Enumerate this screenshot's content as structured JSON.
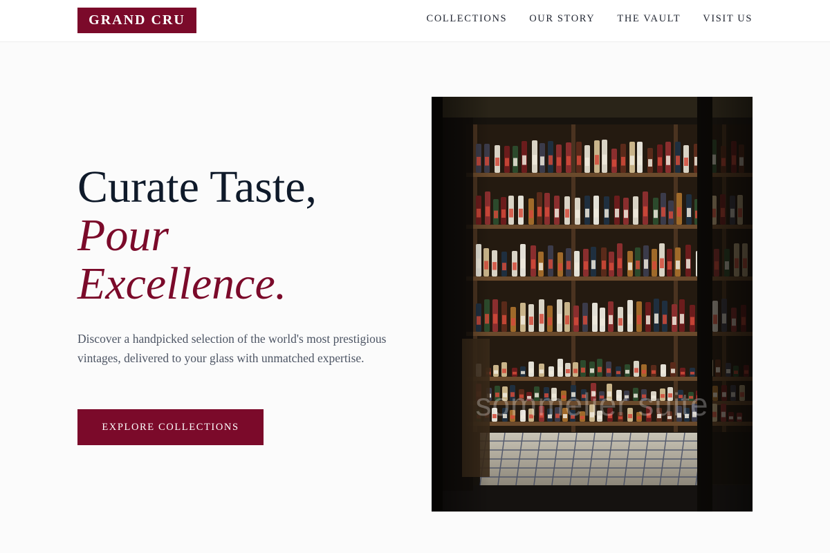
{
  "header": {
    "logo": "GRAND CRU",
    "nav": [
      {
        "label": "COLLECTIONS"
      },
      {
        "label": "OUR STORY"
      },
      {
        "label": "THE VAULT"
      },
      {
        "label": "VISIT US"
      }
    ]
  },
  "hero": {
    "headline_line1": "Curate Taste,",
    "headline_line2": "Pour",
    "headline_line3": "Excellence.",
    "description": "Discover a handpicked selection of the world's most prestigious vintages, delivered to your glass with unmatched expertise.",
    "cta_label": "EXPLORE COLLECTIONS",
    "image_alt": "Bottle shop shelves behind glass doors",
    "watermark": "sommelier suite"
  },
  "colors": {
    "brand": "#7b0a2a",
    "heading": "#0f1a2a",
    "body_text": "#4d5564",
    "background": "#fbfbfb"
  }
}
